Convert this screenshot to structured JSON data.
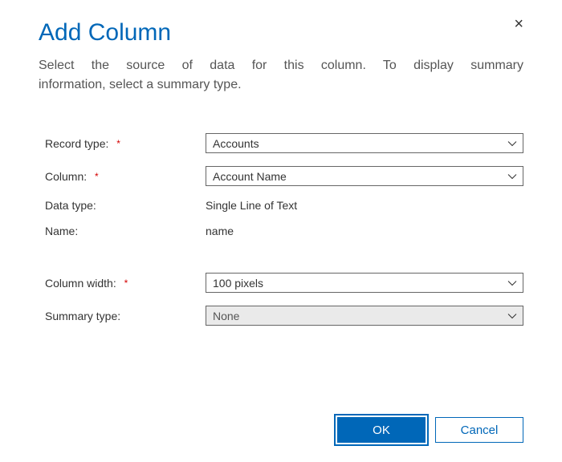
{
  "dialog": {
    "title": "Add Column",
    "subtitle_line1": "Select the source of data for this column. To display summary",
    "subtitle_line2": "information, select a summary type.",
    "close_symbol": "×"
  },
  "fields": {
    "record_type": {
      "label": "Record type:",
      "value": "Accounts",
      "required": true
    },
    "column": {
      "label": "Column:",
      "value": "Account Name",
      "required": true
    },
    "data_type": {
      "label": "Data type:",
      "value": "Single Line of Text"
    },
    "name": {
      "label": "Name:",
      "value": "name"
    },
    "column_width": {
      "label": "Column width:",
      "value": "100 pixels",
      "required": true
    },
    "summary_type": {
      "label": "Summary type:",
      "value": "None",
      "disabled": true
    }
  },
  "buttons": {
    "ok": "OK",
    "cancel": "Cancel"
  }
}
